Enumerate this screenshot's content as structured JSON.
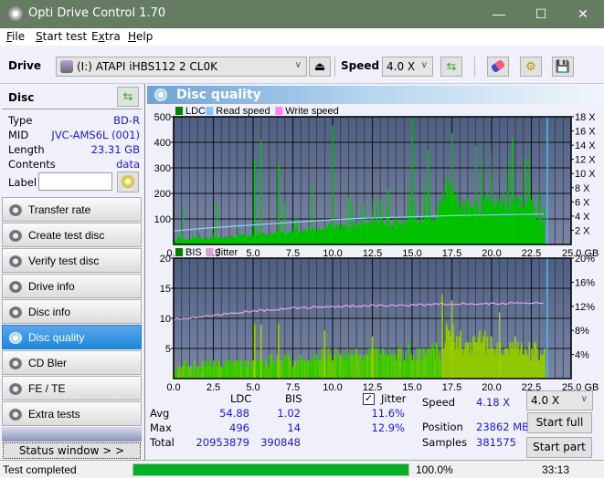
{
  "window": {
    "title": "Opti Drive Control 1.70",
    "minimize": "—",
    "maximize": "☐",
    "close": "✕"
  },
  "menu": [
    {
      "label": "File",
      "u": "F",
      "rest": "ile"
    },
    {
      "label": "Start test",
      "u": "S",
      "rest": "tart test"
    },
    {
      "label": "Extra",
      "u": "E",
      "pre": "",
      "mid": "x",
      "rest": "tra"
    },
    {
      "label": "Help",
      "u": "H",
      "rest": "elp"
    }
  ],
  "toolbar": {
    "drive_label": "Drive",
    "drive_value": "(I:)  ATAPI iHBS112   2 CL0K",
    "speed_label": "Speed",
    "speed_value": "4.0 X"
  },
  "disc": {
    "header": "Disc",
    "rows": [
      {
        "k": "Type",
        "v": "BD-R"
      },
      {
        "k": "MID",
        "v": "JVC-AMS6L (001)"
      },
      {
        "k": "Length",
        "v": "23.31 GB"
      },
      {
        "k": "Contents",
        "v": "data"
      }
    ],
    "label_key": "Label",
    "label_value": ""
  },
  "nav": [
    {
      "label": "Transfer rate"
    },
    {
      "label": "Create test disc"
    },
    {
      "label": "Verify test disc"
    },
    {
      "label": "Drive info"
    },
    {
      "label": "Disc info"
    },
    {
      "label": "Disc quality",
      "active": true
    },
    {
      "label": "CD Bler"
    },
    {
      "label": "FE / TE"
    },
    {
      "label": "Extra tests"
    }
  ],
  "status_window_btn": "Status window > >",
  "panel": {
    "title": "Disc quality"
  },
  "chart_data": [
    {
      "type": "area",
      "title": "LDC",
      "legend": [
        "LDC",
        "Read speed",
        "Write speed"
      ],
      "legend_colors": [
        "#008000",
        "#80c8ff",
        "#ff80ff"
      ],
      "xlim": [
        0,
        25
      ],
      "xticks": [
        "0.0",
        "2.5",
        "5.0",
        "7.5",
        "10.0",
        "12.5",
        "15.0",
        "17.5",
        "20.0",
        "22.5",
        "25.0 GB"
      ],
      "ylim": [
        0,
        500
      ],
      "yticks": [
        "100",
        "200",
        "300",
        "400",
        "500"
      ],
      "y2ticks": [
        "2 X",
        "4 X",
        "6 X",
        "8 X",
        "10 X",
        "12 X",
        "14 X",
        "16 X",
        "18 X"
      ],
      "y2lim": [
        0,
        18
      ],
      "ldc_base": [
        [
          0,
          20
        ],
        [
          2.5,
          25
        ],
        [
          5,
          35
        ],
        [
          7.5,
          50
        ],
        [
          10,
          70
        ],
        [
          12.5,
          85
        ],
        [
          15,
          95
        ],
        [
          16.5,
          110
        ],
        [
          17.2,
          230
        ],
        [
          18,
          150
        ],
        [
          20,
          170
        ],
        [
          22.5,
          160
        ],
        [
          23.3,
          60
        ]
      ],
      "ldc_spikes": [
        [
          0.6,
          155
        ],
        [
          2.7,
          160
        ],
        [
          5.1,
          335
        ],
        [
          5.5,
          410
        ],
        [
          6.6,
          320
        ],
        [
          7,
          165
        ],
        [
          8.7,
          235
        ],
        [
          10,
          465
        ],
        [
          11,
          185
        ],
        [
          11.8,
          160
        ],
        [
          13.5,
          220
        ],
        [
          15,
          500
        ],
        [
          16,
          370
        ],
        [
          17.5,
          435
        ],
        [
          19,
          385
        ],
        [
          21.3,
          420
        ],
        [
          22.1,
          340
        ]
      ],
      "read_speed": [
        [
          0,
          1.9
        ],
        [
          1,
          2.1
        ],
        [
          2,
          2.3
        ],
        [
          4,
          2.6
        ],
        [
          6,
          2.9
        ],
        [
          8,
          3.2
        ],
        [
          10,
          3.5
        ],
        [
          12,
          3.7
        ],
        [
          15,
          3.9
        ],
        [
          18,
          4.1
        ],
        [
          21,
          4.2
        ],
        [
          23.3,
          4.3
        ]
      ]
    },
    {
      "type": "bar",
      "title": "BIS",
      "legend": [
        "BIS",
        "Jitter"
      ],
      "legend_colors": [
        "#008000",
        "#d8a0d8"
      ],
      "xlim": [
        0,
        25
      ],
      "xticks": [
        "0.0",
        "2.5",
        "5.0",
        "7.5",
        "10.0",
        "12.5",
        "15.0",
        "17.5",
        "20.0",
        "22.5",
        "25.0 GB"
      ],
      "ylim": [
        0,
        20
      ],
      "yticks": [
        "5",
        "10",
        "15",
        "20"
      ],
      "y2ticks": [
        "4%",
        "8%",
        "12%",
        "16%",
        "20%"
      ],
      "y2lim": [
        0,
        20
      ],
      "bis_base": [
        [
          0,
          2
        ],
        [
          5,
          3
        ],
        [
          10,
          4
        ],
        [
          16.9,
          5
        ],
        [
          17,
          9
        ],
        [
          17.8,
          7
        ],
        [
          23.3,
          5
        ]
      ],
      "bis_spikes": [
        [
          5.1,
          9
        ],
        [
          5.5,
          9
        ],
        [
          6.6,
          9
        ],
        [
          9.5,
          8
        ],
        [
          12.5,
          7
        ],
        [
          16.9,
          14
        ],
        [
          17.5,
          13
        ],
        [
          20.5,
          11
        ]
      ],
      "jitter": [
        [
          0,
          9.8
        ],
        [
          2.5,
          10.5
        ],
        [
          5,
          11.2
        ],
        [
          7.5,
          11.7
        ],
        [
          10,
          12.0
        ],
        [
          12.5,
          12.1
        ],
        [
          15,
          12.2
        ],
        [
          17.5,
          12.4
        ],
        [
          20,
          12.5
        ],
        [
          22.5,
          12.6
        ],
        [
          23.3,
          12.4
        ]
      ]
    }
  ],
  "stats": {
    "cols": [
      "LDC",
      "BIS"
    ],
    "rows": [
      {
        "k": "Avg",
        "ldc": "54.88",
        "bis": "1.02",
        "jit": "11.6%"
      },
      {
        "k": "Max",
        "ldc": "496",
        "bis": "14",
        "jit": "12.9%"
      },
      {
        "k": "Total",
        "ldc": "20953879",
        "bis": "390848",
        "jit": ""
      }
    ],
    "jitter_label": "Jitter",
    "jitter_checked": true,
    "speed_k": "Speed",
    "speed_v": "4.18 X",
    "position_k": "Position",
    "position_v": "23862 MB",
    "samples_k": "Samples",
    "samples_v": "381575",
    "speed_select": "4.0 X",
    "start_full": "Start full",
    "start_part": "Start part"
  },
  "statusbar": {
    "text": "Test completed",
    "progress": 1.0,
    "percent": "100.0%",
    "time": "33:13"
  }
}
